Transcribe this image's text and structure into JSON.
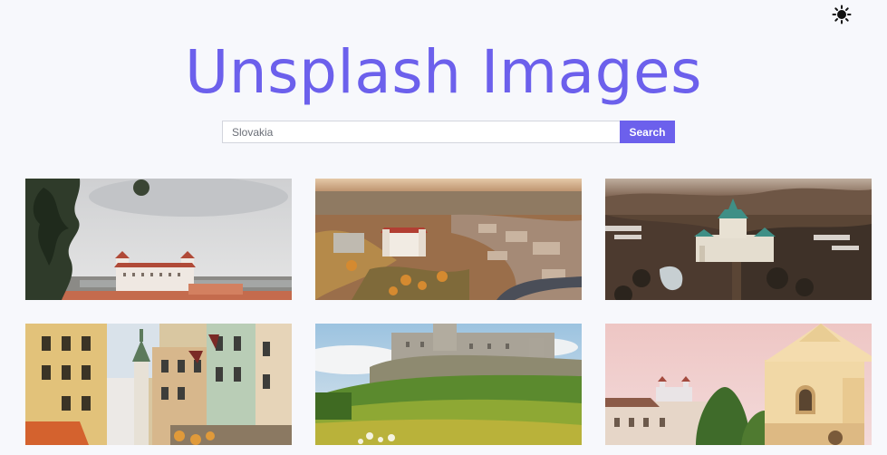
{
  "header": {
    "title": "Unsplash Images",
    "theme_toggle_icon": "sun-icon"
  },
  "search": {
    "value": "Slovakia",
    "button_label": "Search",
    "accent_color": "#6c60ec"
  },
  "results": [
    {
      "image": "bratislava-castle-photo"
    },
    {
      "image": "bratislava-aerial-photo"
    },
    {
      "image": "bojnice-castle-photo"
    },
    {
      "image": "old-town-street-photo"
    },
    {
      "image": "spis-castle-photo"
    },
    {
      "image": "bratislava-church-photo"
    }
  ]
}
